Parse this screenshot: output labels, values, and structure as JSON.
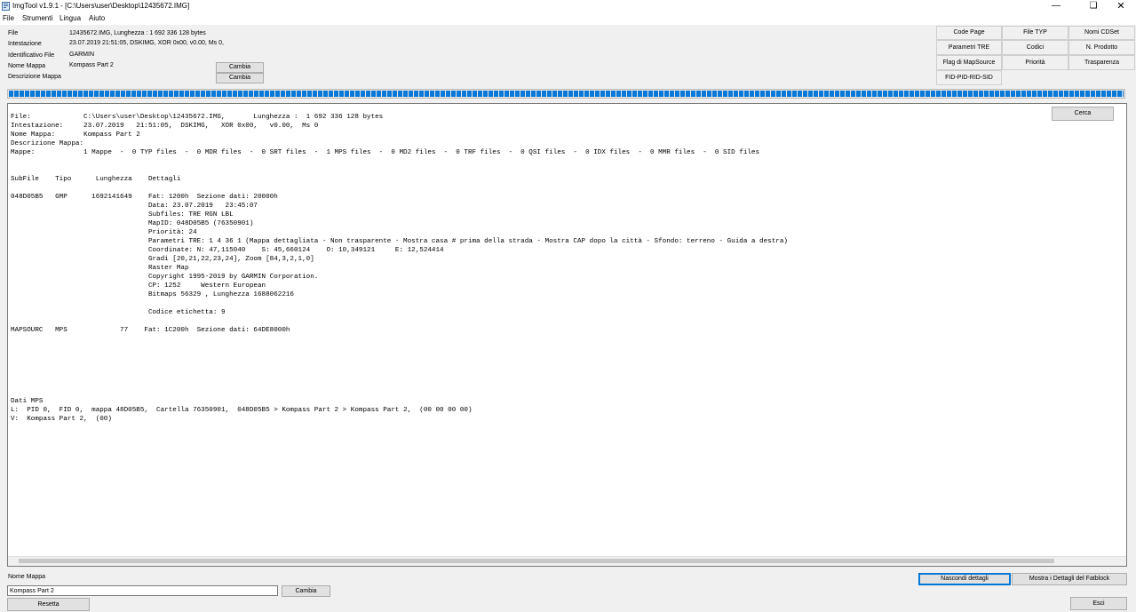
{
  "window": {
    "title": "ImgTool v1.9.1 - [C:\\Users\\user\\Desktop\\12435672.IMG]"
  },
  "menu": [
    "File",
    "Strumenti",
    "Lingua",
    "Aiuto"
  ],
  "info": {
    "file_label": "File",
    "file_value": "12435672.IMG,     Lunghezza :  1 692 336 128 bytes",
    "header_label": "Intestazione",
    "header_value": "23.07.2019   21:51:05,  DSKIMG,   XOR 0x00,   v0.00,  Ms 0,",
    "fileid_label": "Identificativo File",
    "fileid_value": "GARMIN",
    "mapname_label": "Nome Mappa",
    "mapname_value": "Kompass Part 2",
    "mapdesc_label": "Descrizione Mappa",
    "change_label": "Cambia"
  },
  "toolbar": [
    "Code Page",
    "File TYP",
    "Nomi CDSet",
    "Parametri TRE",
    "Codici",
    "N. Prodotto",
    "Flag di MapSource",
    "Priorità",
    "Trasparenza",
    "FID-PID-RID-SID"
  ],
  "progress": {
    "percent": 100,
    "color": "#0a78d7"
  },
  "search_label": "Cerca",
  "details_lines": [
    "File:             C:\\Users\\user\\Desktop\\12435672.IMG,       Lunghezza :  1 692 336 128 bytes",
    "Intestazione:     23.07.2019   21:51:05,  DSKIMG,   XOR 0x00,   v0.00,  Ms 0",
    "Nome Mappa:       Kompass Part 2",
    "Descrizione Mappa:",
    "Mappe:            1 Mappe  -  0 TYP files  -  0 MDR files  -  0 SRT files  -  1 MPS files  -  0 MD2 files  -  0 TRF files  -  0 QSI files  -  0 IDX files  -  0 MMR files  -  0 SID files",
    "",
    "",
    "SubFile    Tipo      Lunghezza    Dettagli",
    "",
    "048D05B5   GMP      1692141649    Fat: 1200h  Sezione dati: 20000h",
    "                                  Data: 23.07.2019   23:45:07",
    "                                  Subfiles: TRE RGN LBL",
    "                                  MapID: 048D05B5 (76350901)",
    "                                  Priorità: 24",
    "                                  Parametri TRE: 1 4 36 1 (Mappa dettagliata - Non trasparente - Mostra casa # prima della strada - Mostra CAP dopo la città - Sfondo: terreno - Guida a destra)",
    "                                  Coordinate: N: 47,115040    S: 45,660124    O: 10,349121     E: 12,524414",
    "                                  Gradi [20,21,22,23,24], Zoom [84,3,2,1,0]",
    "                                  Raster Map",
    "                                  Copyright 1995-2019 by GARMIN Corporation.",
    "                                  CP: 1252     Western European",
    "                                  Bitmaps 56329 , Lunghezza 1688062216",
    "",
    "                                  Codice etichetta: 9",
    "",
    "MAPSOURC   MPS             77    Fat: 1C200h  Sezione dati: 64DE8000h",
    "",
    "",
    "",
    "",
    "",
    "",
    "",
    "Dati MPS",
    "L:  PID 0,  FID 0,  mappa 48D05B5,  Cartella 76350901,  048D05B5 > Kompass Part 2 > Kompass Part 2,  (00 00 00 00)",
    "V:  Kompass Part 2,  (00)"
  ],
  "bottom": {
    "map_name_label": "Nome Mappa",
    "map_name_value": "Kompass Part 2",
    "change_label": "Cambia",
    "reset_label": "Resetta",
    "hide_details_label": "Nascondi dettagli",
    "show_fatblock_label": "Mostra i Dettagli del Fatblock",
    "exit_label": "Esci"
  }
}
